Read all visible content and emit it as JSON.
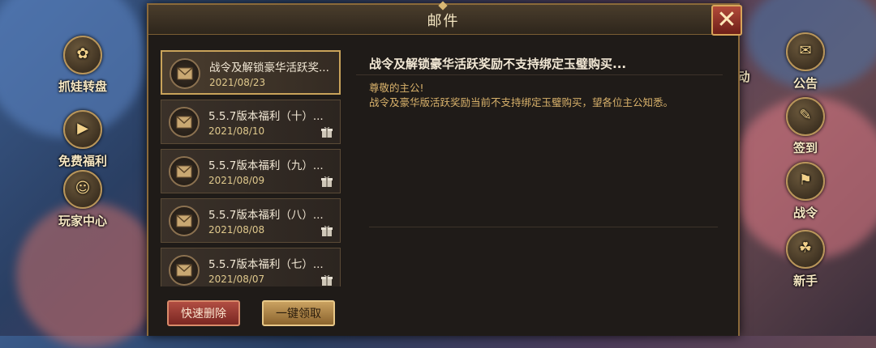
{
  "background": {
    "left_buttons": [
      {
        "label": "抓娃转盘",
        "icon": "wheel-icon",
        "glyph": "✿"
      },
      {
        "label": "免费福利",
        "icon": "play-icon",
        "glyph": "▶"
      },
      {
        "label": "玩家中心",
        "icon": "avatar-icon",
        "glyph": "☺"
      }
    ],
    "right_buttons": [
      {
        "label": "公告",
        "icon": "notice-icon",
        "glyph": "✉"
      },
      {
        "label": "签到",
        "icon": "checkin-icon",
        "glyph": "✎"
      },
      {
        "label": "战令",
        "icon": "battle-pass-icon",
        "glyph": "⚑"
      },
      {
        "label": "新手",
        "icon": "newbie-icon",
        "glyph": "☘"
      }
    ],
    "right_edge_partial_label": "动"
  },
  "modal": {
    "title": "邮件",
    "close_glyph": "✕"
  },
  "mail_list": [
    {
      "title": "战令及解锁豪华活跃奖...",
      "date": "2021/08/23",
      "selected": true,
      "has_gift": false
    },
    {
      "title": "5.5.7版本福利（十）...",
      "date": "2021/08/10",
      "selected": false,
      "has_gift": true
    },
    {
      "title": "5.5.7版本福利（九）...",
      "date": "2021/08/09",
      "selected": false,
      "has_gift": true
    },
    {
      "title": "5.5.7版本福利（八）...",
      "date": "2021/08/08",
      "selected": false,
      "has_gift": true
    },
    {
      "title": "5.5.7版本福利（七）...",
      "date": "2021/08/07",
      "selected": false,
      "has_gift": true
    }
  ],
  "content": {
    "title": "战令及解锁豪华活跃奖励不支持绑定玉璧购买...",
    "greeting": "尊敬的主公!",
    "body": "战令及豪华版活跃奖励当前不支持绑定玉璧购买，望各位主公知悉。"
  },
  "buttons": {
    "quick_delete": "快速删除",
    "claim_all": "一键领取"
  },
  "colors": {
    "accent_gold": "#c9a35a",
    "text_gold": "#d9b26b",
    "delete_red": "#9a3a30"
  }
}
